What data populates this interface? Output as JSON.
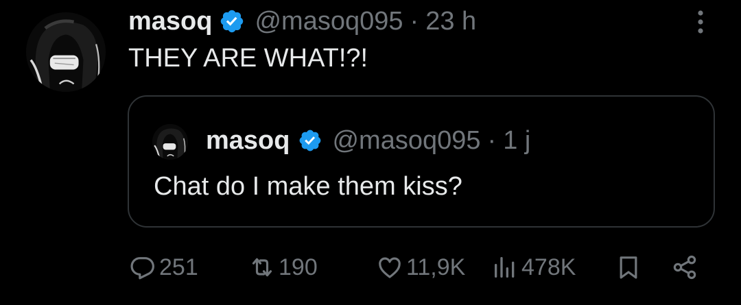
{
  "tweet": {
    "author": {
      "name": "masoq",
      "handle": "@masoq095",
      "verified": true
    },
    "separator": "·",
    "time": "23 h",
    "text": "THEY ARE WHAT!?!",
    "more_icon": "more-vertical-icon"
  },
  "quoted_tweet": {
    "author": {
      "name": "masoq",
      "handle": "@masoq095",
      "verified": true
    },
    "separator": "·",
    "time": "1 j",
    "text": "Chat do I make them kiss?"
  },
  "actions": {
    "replies": "251",
    "retweets": "190",
    "likes": "11,9K",
    "views": "478K"
  },
  "colors": {
    "background": "#000000",
    "text": "#e7e9ea",
    "muted": "#71767b",
    "verified": "#1d9bf0",
    "border": "#2f3336"
  }
}
